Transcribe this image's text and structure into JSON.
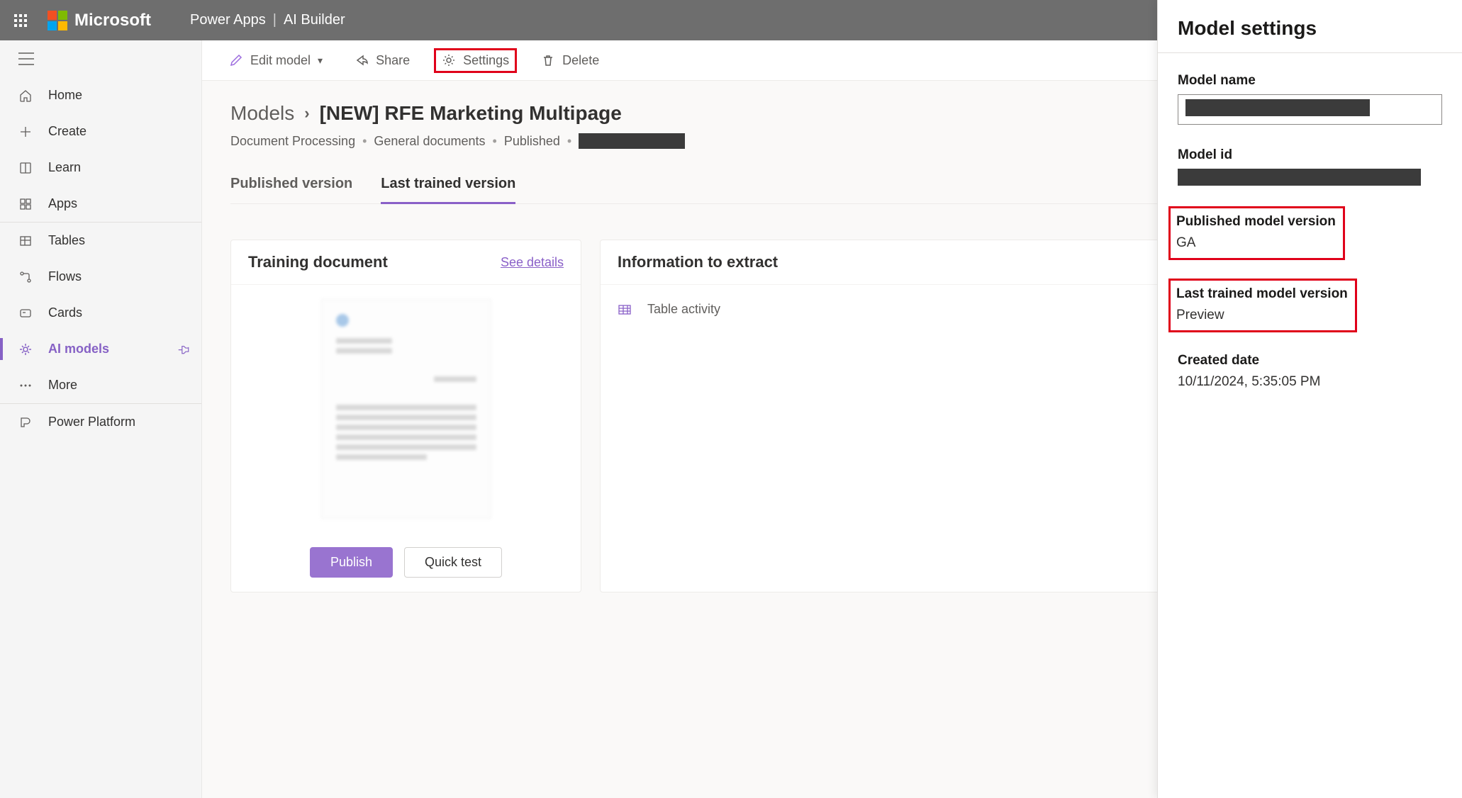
{
  "brand": {
    "company": "Microsoft",
    "app": "Power Apps",
    "section": "AI Builder"
  },
  "nav": {
    "home": "Home",
    "create": "Create",
    "learn": "Learn",
    "apps": "Apps",
    "tables": "Tables",
    "flows": "Flows",
    "cards": "Cards",
    "ai_models": "AI models",
    "more": "More",
    "power_platform": "Power Platform"
  },
  "commands": {
    "edit_model": "Edit model",
    "share": "Share",
    "settings": "Settings",
    "delete": "Delete"
  },
  "page": {
    "breadcrumb_root": "Models",
    "title": "[NEW] RFE Marketing Multipage",
    "meta": {
      "type": "Document Processing",
      "subtype": "General documents",
      "status": "Published"
    },
    "tabs": {
      "published": "Published version",
      "last_trained": "Last trained version"
    }
  },
  "training_card": {
    "title": "Training document",
    "see_details": "See details",
    "publish_btn": "Publish",
    "quick_test_btn": "Quick test"
  },
  "info_card": {
    "title": "Information to extract",
    "item1": "Table activity"
  },
  "settings_panel": {
    "title": "Model settings",
    "model_name_label": "Model name",
    "model_id_label": "Model id",
    "published_version_label": "Published model version",
    "published_version_value": "GA",
    "last_trained_label": "Last trained model version",
    "last_trained_value": "Preview",
    "created_date_label": "Created date",
    "created_date_value": "10/11/2024, 5:35:05 PM"
  }
}
